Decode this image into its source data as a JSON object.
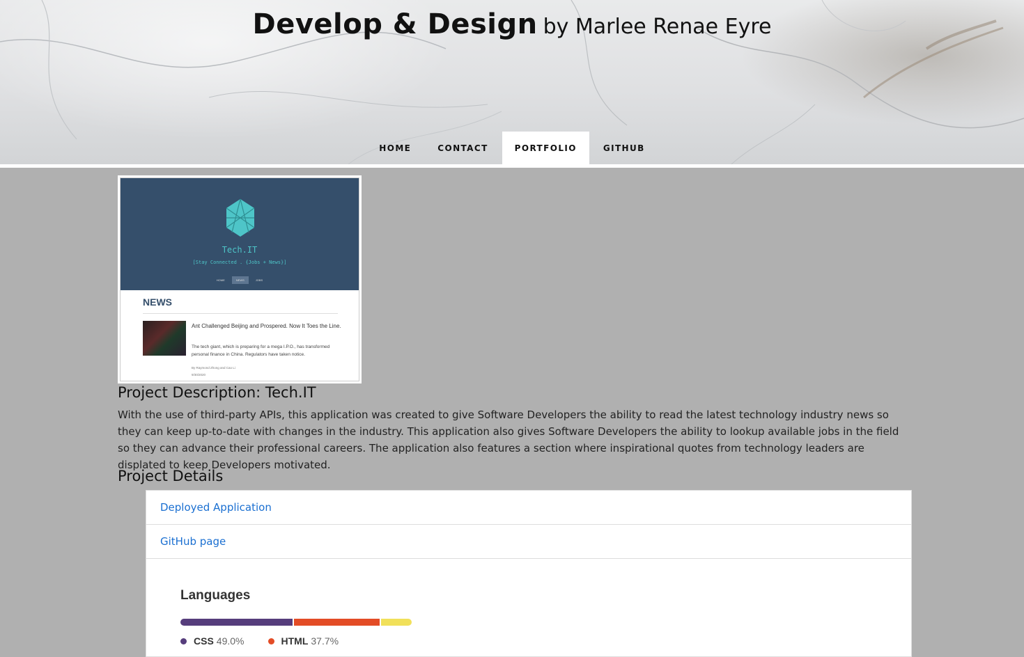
{
  "header": {
    "title": "Develop & Design",
    "byline": "by Marlee Renae Eyre",
    "nav": [
      {
        "label": "HOME"
      },
      {
        "label": "CONTACT"
      },
      {
        "label": "PORTFOLIO",
        "active": true
      },
      {
        "label": "GITHUB"
      }
    ]
  },
  "thumbnail": {
    "app_name": "Tech.IT",
    "tagline": "[Stay Connected . {Jobs + News}]",
    "nav": [
      "HOME",
      "NEWS",
      "JOBS"
    ],
    "section": "NEWS",
    "headline": "Ant Challenged Beijing and Prospered. Now It Toes the Line.",
    "summary": "The tech giant, which is preparing for a mega I.P.O., has transformed personal finance in China. Regulators have taken notice.",
    "byline": "By Raymond Zhong and Cao Li",
    "date": "9/30/2020"
  },
  "project": {
    "title": "Project Description: Tech.IT",
    "description": "With the use of third-party APIs, this application was created to give Software Developers the ability to read the latest technology industry news so they can keep up-to-date with changes in the industry. This application also gives Software Developers the ability to lookup available jobs in the field so they can advance their professional careers. The application also features a section where inspirational quotes from technology leaders are displated to keep Developers motivated.",
    "details_title": "Project Details",
    "links": [
      {
        "label": "Deployed Application"
      },
      {
        "label": "GitHub page"
      }
    ]
  },
  "languages": {
    "title": "Languages",
    "items": [
      {
        "name": "CSS",
        "percent_label": "49.0%",
        "fraction": 0.49,
        "color": "#563d7c"
      },
      {
        "name": "HTML",
        "percent_label": "37.7%",
        "fraction": 0.377,
        "color": "#e34c26"
      },
      {
        "name": "",
        "percent_label": "",
        "fraction": 0.133,
        "color": "#f1e05a"
      }
    ]
  },
  "colors": {
    "page_bg": "#b0b0b0",
    "link": "#1a6fd1",
    "thumb_header": "#354f6b",
    "thumb_accent": "#4ec5c8"
  }
}
